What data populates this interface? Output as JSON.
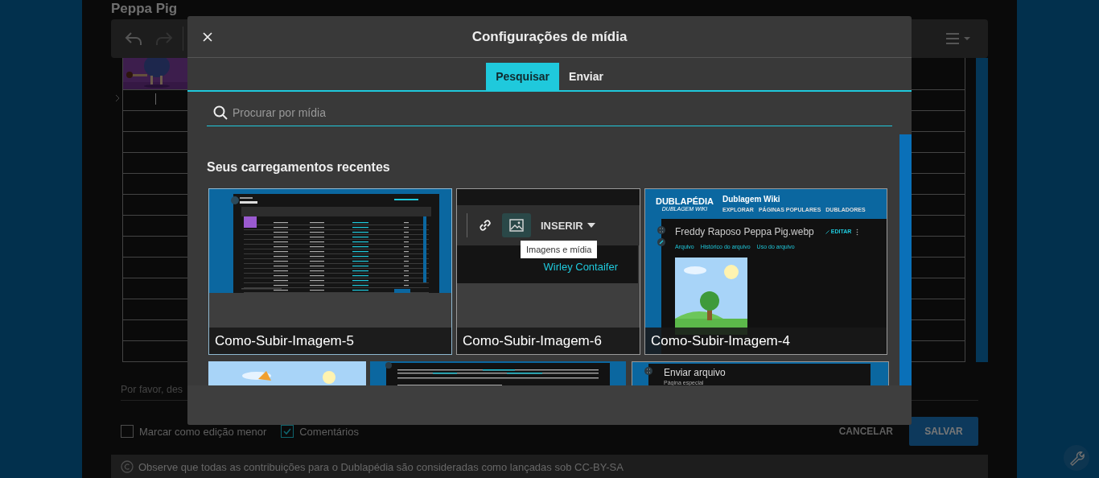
{
  "page": {
    "title": "Peppa Pig"
  },
  "summary": {
    "placeholder": "Por favor, des"
  },
  "options": [
    {
      "label": "Marcar como edição menor",
      "checked": false
    },
    {
      "label": "Comentários",
      "checked": true
    }
  ],
  "actions": [
    {
      "label": "CANCELAR",
      "kind": "text"
    },
    {
      "label": "SALVAR",
      "kind": "primary"
    }
  ],
  "license_notice": "Observe que todas as contribuições para o Dublapédia são consideradas como lançadas sob CC-BY-SA",
  "media_dialog": {
    "title": "Configurações de mídia",
    "tabs": [
      {
        "label": "Pesquisar",
        "selected": true
      },
      {
        "label": "Enviar",
        "selected": false
      }
    ],
    "search": {
      "placeholder": "Procurar por mídia"
    },
    "section_title": "Seus carregamentos recentes",
    "items": [
      {
        "kind": "table-screenshot",
        "caption": "Como-Subir-Imagem-5"
      },
      {
        "kind": "toolbar-screenshot",
        "caption": "Como-Subir-Imagem-6",
        "button": "INSERIR",
        "tooltip": "Imagens e mídia",
        "link": "Wirley Contaifer"
      },
      {
        "kind": "file-page-screenshot",
        "caption": "Como-Subir-Imagem-4",
        "logo": "DUBLAPÉDIA",
        "logo_sub": "DUBLAGEM WIKI",
        "site": "Dublagem Wiki",
        "nav": [
          "EXPLORAR",
          "PÁGINAS POPULARES",
          "DUBLADORES"
        ],
        "file_title": "Freddy Raposo Peppa Pig.webp",
        "edit": "EDITAR",
        "tabs": [
          "Arquivo",
          "Histórico do arquivo",
          "Uso do arquivo"
        ]
      },
      {
        "kind": "picture"
      },
      {
        "kind": "text-page-screenshot"
      },
      {
        "kind": "upload-screenshot",
        "heading": "Enviar arquivo",
        "subheading": "Página especial"
      }
    ]
  }
}
